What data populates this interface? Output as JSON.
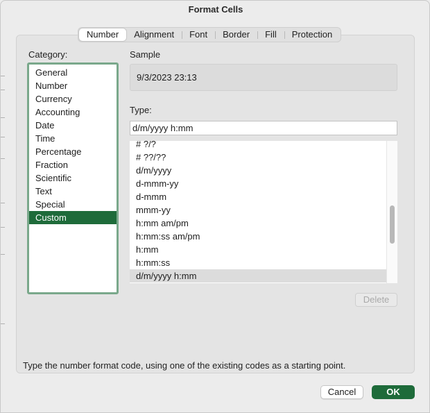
{
  "dialog": {
    "title": "Format Cells"
  },
  "tabs": [
    {
      "label": "Number",
      "active": true
    },
    {
      "label": "Alignment"
    },
    {
      "label": "Font"
    },
    {
      "label": "Border"
    },
    {
      "label": "Fill"
    },
    {
      "label": "Protection"
    }
  ],
  "category": {
    "label": "Category:",
    "items": [
      "General",
      "Number",
      "Currency",
      "Accounting",
      "Date",
      "Time",
      "Percentage",
      "Fraction",
      "Scientific",
      "Text",
      "Special",
      "Custom"
    ],
    "selected": "Custom"
  },
  "sample": {
    "label": "Sample",
    "value": "9/3/2023 23:13"
  },
  "type": {
    "label": "Type:",
    "value": "d/m/yyyy h:mm",
    "formats": [
      "# ?/?",
      "# ??/??",
      "d/m/yyyy",
      "d-mmm-yy",
      "d-mmm",
      "mmm-yy",
      "h:mm am/pm",
      "h:mm:ss am/pm",
      "h:mm",
      "h:mm:ss",
      "d/m/yyyy h:mm"
    ],
    "selected": "d/m/yyyy h:mm"
  },
  "buttons": {
    "delete": "Delete",
    "cancel": "Cancel",
    "ok": "OK"
  },
  "hint": "Type the number format code, using one of the existing codes as a starting point.",
  "colors": {
    "accent": "#1e6b3a",
    "list_border": "#7aa88b"
  }
}
